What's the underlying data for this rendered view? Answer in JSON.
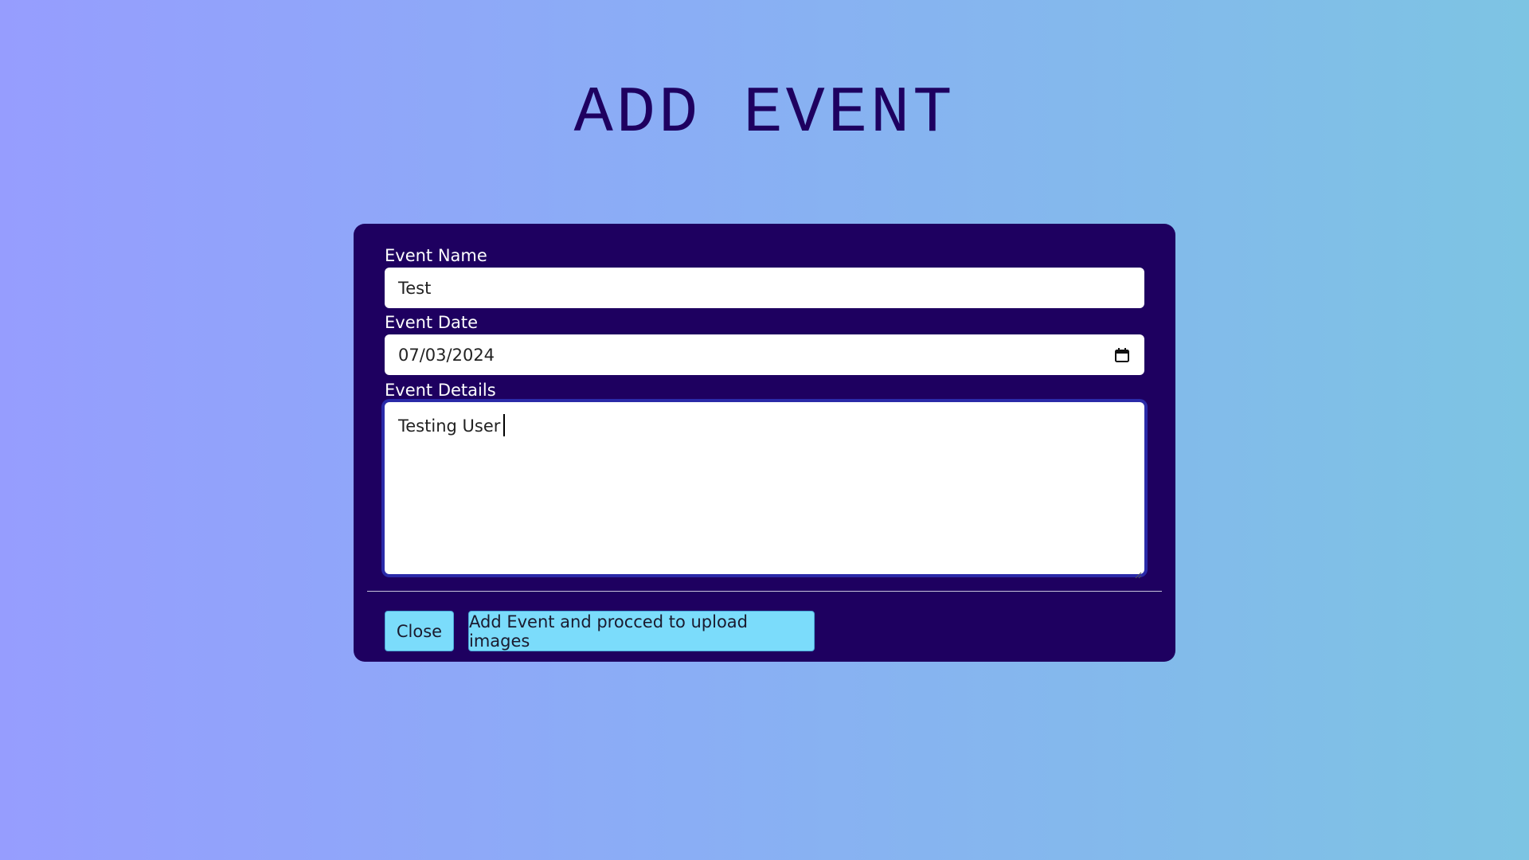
{
  "page": {
    "title": "ADD EVENT"
  },
  "form": {
    "event_name": {
      "label": "Event Name",
      "value": "Test"
    },
    "event_date": {
      "label": "Event Date",
      "value": "07/03/2024",
      "icon": "calendar-icon"
    },
    "event_details": {
      "label": "Event Details",
      "value": "Testing User"
    }
  },
  "actions": {
    "close_label": "Close",
    "add_label": "Add Event and procced to upload images"
  },
  "colors": {
    "card_background": "#1e0060",
    "title": "#1e0060",
    "button": "#7bdcfb",
    "gradient_start": "#969dfe",
    "gradient_end": "#7dc4e3"
  }
}
